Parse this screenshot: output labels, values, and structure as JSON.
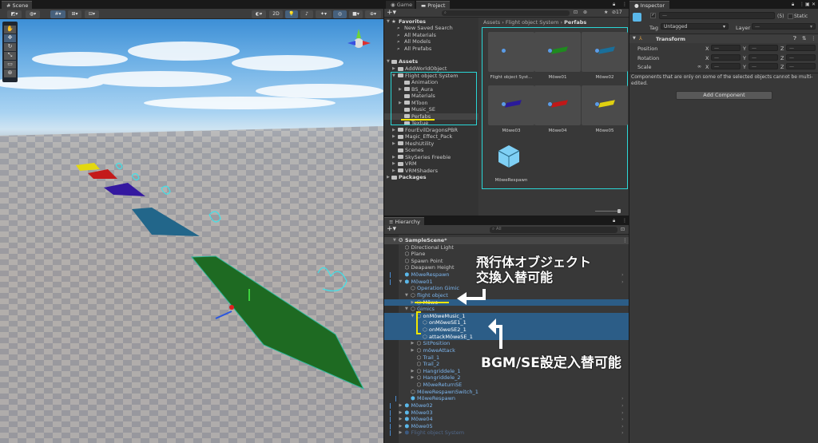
{
  "scene": {
    "tab": "Scene",
    "toolbar": {
      "mode_2d": "2D"
    },
    "tools": [
      "hand-tool",
      "move-tool",
      "rotate-tool",
      "scale-tool",
      "rect-tool",
      "transform-tool"
    ]
  },
  "project": {
    "tabs": [
      "Game",
      "Project"
    ],
    "hidden_count": "17",
    "favorites_label": "Favorites",
    "favorites": [
      "New Saved Search",
      "All Materials",
      "All Models",
      "All Prefabs"
    ],
    "assets_label": "Assets",
    "assets": [
      {
        "label": "AddWorldObject",
        "level": 1,
        "arrow": "▶"
      },
      {
        "label": "Flight object System",
        "level": 1,
        "arrow": "▼"
      },
      {
        "label": "Animation",
        "level": 2,
        "arrow": ""
      },
      {
        "label": "BS_Aura",
        "level": 2,
        "arrow": "▶"
      },
      {
        "label": "Materials",
        "level": 2,
        "arrow": ""
      },
      {
        "label": "MToon",
        "level": 2,
        "arrow": "▶"
      },
      {
        "label": "Music_SE",
        "level": 2,
        "arrow": ""
      },
      {
        "label": "Perfabs",
        "level": 2,
        "arrow": "",
        "selected": true
      },
      {
        "label": "Textue",
        "level": 2,
        "arrow": ""
      },
      {
        "label": "FourEvilDragonsPBR",
        "level": 1,
        "arrow": "▶"
      },
      {
        "label": "Magic_Effect_Pack",
        "level": 1,
        "arrow": "▶"
      },
      {
        "label": "MeshUtility",
        "level": 1,
        "arrow": "▶"
      },
      {
        "label": "Scenes",
        "level": 1,
        "arrow": ""
      },
      {
        "label": "SkySeries Freebie",
        "level": 1,
        "arrow": "▶"
      },
      {
        "label": "VRM",
        "level": 1,
        "arrow": "▶"
      },
      {
        "label": "VRMShaders",
        "level": 1,
        "arrow": "▶"
      }
    ],
    "packages_label": "Packages",
    "breadcrumb": [
      "Assets",
      "Flight object System",
      "Perfabs"
    ],
    "grid": [
      {
        "label": "Flight object Syst...",
        "color": ""
      },
      {
        "label": "Möwe01",
        "color": "#1f8a1f"
      },
      {
        "label": "Möwe02",
        "color": "#1a6f9a"
      },
      {
        "label": "Möwe03",
        "color": "#2a1a9a"
      },
      {
        "label": "Möwe04",
        "color": "#c01818"
      },
      {
        "label": "Möwe05",
        "color": "#e0d010"
      },
      {
        "label": "MöweRespawn",
        "color": "cube"
      }
    ]
  },
  "hierarchy": {
    "tab": "Hierarchy",
    "search_placeholder": "All",
    "rows": [
      {
        "label": "SampleScene*",
        "level": 0,
        "arrow": "▼",
        "style": "scene"
      },
      {
        "label": "Directional Light",
        "level": 1
      },
      {
        "label": "Plane",
        "level": 1
      },
      {
        "label": "Spawn Point",
        "level": 1
      },
      {
        "label": "Deapawn Height",
        "level": 1
      },
      {
        "label": "MöweRespawn",
        "level": 1,
        "style": "prefab",
        "more": true
      },
      {
        "label": "Möwe01",
        "level": 1,
        "arrow": "▼",
        "style": "prefab",
        "more": true
      },
      {
        "label": "Operation Gimic",
        "level": 2,
        "style": "blue"
      },
      {
        "label": "flight object",
        "level": 2,
        "arrow": "▼",
        "style": "blue"
      },
      {
        "label": "Möwe",
        "level": 3,
        "arrow": "▶",
        "style": "blue",
        "selected": true
      },
      {
        "label": "Gimics",
        "level": 2,
        "arrow": "▼",
        "style": "blue"
      },
      {
        "label": "onMöweMusic_1",
        "level": 3,
        "arrow": "▼",
        "selected": true
      },
      {
        "label": "onMöweSE1_1",
        "level": 4,
        "selected": true
      },
      {
        "label": "onMöweSE2_1",
        "level": 4,
        "selected": true
      },
      {
        "label": "attackMöweSE_1",
        "level": 4,
        "selected": true
      },
      {
        "label": "SitPosition",
        "level": 3,
        "arrow": "▶",
        "style": "blue"
      },
      {
        "label": "möweAttack",
        "level": 3,
        "arrow": "▶",
        "style": "blue"
      },
      {
        "label": "Trail_1",
        "level": 3,
        "style": "blue"
      },
      {
        "label": "Trail_2",
        "level": 3,
        "style": "blue"
      },
      {
        "label": "Hangriddele_1",
        "level": 3,
        "arrow": "▶",
        "style": "blue"
      },
      {
        "label": "Hangriddele_2",
        "level": 3,
        "arrow": "▶",
        "style": "blue"
      },
      {
        "label": "MöweReturnSE",
        "level": 3,
        "style": "blue"
      },
      {
        "label": "MöweRespawnSwitch_1",
        "level": 2,
        "style": "blue"
      },
      {
        "label": "MöweRespawn",
        "level": 2,
        "style": "prefab",
        "more": true
      },
      {
        "label": "Möwe02",
        "level": 1,
        "arrow": "▶",
        "style": "prefab",
        "more": true
      },
      {
        "label": "Möwe03",
        "level": 1,
        "arrow": "▶",
        "style": "prefab",
        "more": true
      },
      {
        "label": "Möwe04",
        "level": 1,
        "arrow": "▶",
        "style": "prefab",
        "more": true
      },
      {
        "label": "Möwe05",
        "level": 1,
        "arrow": "▶",
        "style": "prefab",
        "more": true
      },
      {
        "label": "Flight object System",
        "level": 1,
        "arrow": "▶",
        "style": "dim",
        "more": true
      }
    ]
  },
  "annotations": {
    "swap_object_line1": "飛行体オブジェクト",
    "swap_object_line2": "交換入替可能",
    "bgm_se": "BGM/SE設定入替可能"
  },
  "inspector": {
    "tab": "Inspector",
    "name_value": "—",
    "count": "(5)",
    "static_label": "Static",
    "tag_label": "Tag",
    "tag_value": "Untagged",
    "layer_label": "Layer",
    "layer_value": "—",
    "transform_label": "Transform",
    "position_label": "Position",
    "rotation_label": "Rotation",
    "scale_label": "Scale",
    "axis": [
      "X",
      "Y",
      "Z"
    ],
    "mixed": "—",
    "notice": "Components that are only on some of the selected objects cannot be multi-edited.",
    "add_component": "Add Component"
  },
  "colors": {
    "selection": "#2c5d87",
    "highlight_cyan": "#2ad6d6",
    "highlight_yellow": "#f2e600",
    "prefab_blue": "#7cb6ef"
  }
}
